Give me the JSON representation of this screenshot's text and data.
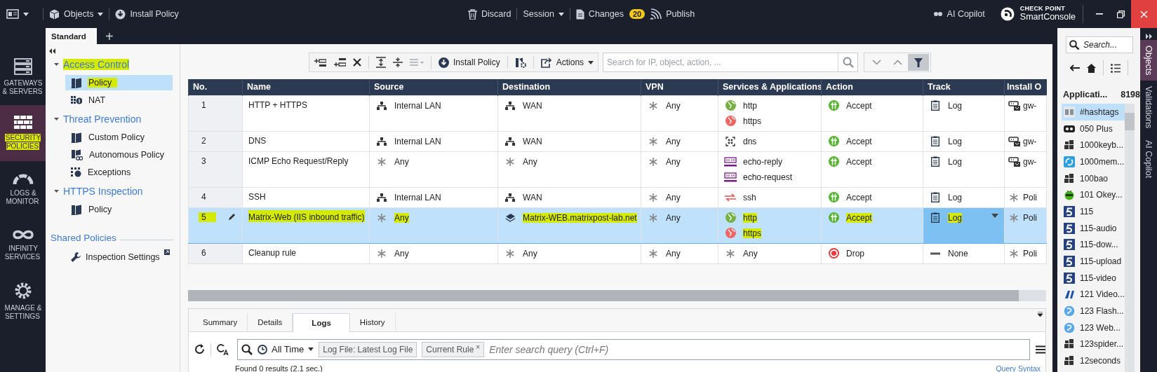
{
  "top_bar": {
    "objects_menu": "Objects",
    "install_policy": "Install Policy",
    "discard": "Discard",
    "session": "Session",
    "changes": "Changes",
    "changes_count": "20",
    "publish": "Publish",
    "ai_copilot": "AI Copilot",
    "brand_top": "CHECK POINT",
    "brand_name": "SmartConsole"
  },
  "policy_tabs": [
    {
      "label": "Standard",
      "selected": true
    }
  ],
  "add_tab": "+",
  "nav": [
    {
      "label": "GATEWAYS & SERVERS",
      "kind": "servers",
      "selected": false,
      "highlighted": false
    },
    {
      "label": "SECURITY POLICIES",
      "kind": "firewall",
      "selected": true,
      "highlighted": true
    },
    {
      "label": "LOGS & MONITOR",
      "kind": "gauge",
      "selected": false,
      "highlighted": false
    },
    {
      "label": "INFINITY SERVICES",
      "kind": "infinity",
      "selected": false,
      "highlighted": false
    },
    {
      "label": "MANAGE & SETTINGS",
      "kind": "gear",
      "selected": false,
      "highlighted": false
    }
  ],
  "tree": [
    {
      "label": "Access Control",
      "expanded": true,
      "highlighted": true,
      "children": [
        {
          "label": "Policy",
          "kind": "policy",
          "selected": true,
          "highlighted": true
        },
        {
          "label": "NAT",
          "kind": "nat",
          "selected": false,
          "highlighted": false
        }
      ]
    },
    {
      "label": "Threat Prevention",
      "expanded": true,
      "highlighted": false,
      "children": [
        {
          "label": "Custom Policy",
          "kind": "policy",
          "selected": false,
          "highlighted": false
        },
        {
          "label": "Autonomous Policy",
          "kind": "autonomous",
          "selected": false,
          "highlighted": false
        },
        {
          "label": "Exceptions",
          "kind": "exceptions",
          "selected": false,
          "highlighted": false
        }
      ]
    },
    {
      "label": "HTTPS Inspection",
      "expanded": true,
      "highlighted": false,
      "children": [
        {
          "label": "Policy",
          "kind": "policy",
          "selected": false,
          "highlighted": false
        }
      ]
    }
  ],
  "shared_policies": {
    "title": "Shared Policies",
    "items": [
      {
        "label": "Inspection Settings",
        "kind": "wrench"
      }
    ]
  },
  "toolbar": {
    "install_policy": "Install Policy",
    "actions": "Actions",
    "search": {
      "placeholder": "Search for IP, object, action, ..."
    }
  },
  "table": {
    "columns": [
      "No.",
      "Name",
      "Source",
      "Destination",
      "VPN",
      "Services & Applications",
      "Action",
      "Track",
      "Install O"
    ],
    "rows": [
      {
        "no": "1",
        "name": "HTTP + HTTPS",
        "source": [
          {
            "kind": "network",
            "text": "Internal LAN"
          }
        ],
        "destination": [
          {
            "kind": "network",
            "text": "WAN"
          }
        ],
        "vpn": [
          {
            "kind": "any",
            "text": "Any"
          }
        ],
        "services": [
          {
            "kind": "globe",
            "color": "#76b043",
            "text": "http"
          },
          {
            "kind": "globe",
            "color": "#f26363",
            "text": "https"
          }
        ],
        "action": {
          "kind": "accept",
          "text": "Accept"
        },
        "track": {
          "kind": "log",
          "text": "Log"
        },
        "install_on": {
          "kind": "gateway",
          "text": "gw-"
        },
        "selected": false,
        "highlighted": false
      },
      {
        "no": "2",
        "name": "DNS",
        "source": [
          {
            "kind": "network",
            "text": "Internal LAN"
          }
        ],
        "destination": [
          {
            "kind": "network",
            "text": "WAN"
          }
        ],
        "vpn": [
          {
            "kind": "any",
            "text": "Any"
          }
        ],
        "services": [
          {
            "kind": "dns",
            "text": "dns"
          }
        ],
        "action": {
          "kind": "accept",
          "text": "Accept"
        },
        "track": {
          "kind": "log",
          "text": "Log"
        },
        "install_on": {
          "kind": "gateway",
          "text": "gw-"
        },
        "selected": false,
        "highlighted": false
      },
      {
        "no": "3",
        "name": "ICMP Echo Request/Reply",
        "source": [
          {
            "kind": "any",
            "text": "Any"
          }
        ],
        "destination": [
          {
            "kind": "any",
            "text": "Any"
          }
        ],
        "vpn": [
          {
            "kind": "any",
            "text": "Any"
          }
        ],
        "services": [
          {
            "kind": "icmp",
            "text": "echo-reply"
          },
          {
            "kind": "icmp",
            "text": "echo-request"
          }
        ],
        "action": {
          "kind": "accept",
          "text": "Accept"
        },
        "track": {
          "kind": "log",
          "text": "Log"
        },
        "install_on": {
          "kind": "gateway",
          "text": "gw-"
        },
        "selected": false,
        "highlighted": false
      },
      {
        "no": "4",
        "name": "SSH",
        "source": [
          {
            "kind": "network",
            "text": "Internal LAN"
          }
        ],
        "destination": [
          {
            "kind": "network",
            "text": "WAN"
          }
        ],
        "vpn": [
          {
            "kind": "any",
            "text": "Any"
          }
        ],
        "services": [
          {
            "kind": "ssh",
            "text": "ssh"
          }
        ],
        "action": {
          "kind": "accept",
          "text": "Accept"
        },
        "track": {
          "kind": "log",
          "text": "Log"
        },
        "install_on": {
          "kind": "any",
          "text": "Poli"
        },
        "selected": false,
        "highlighted": false
      },
      {
        "no": "5",
        "name": "Matrix-Web (IIS inbound traffic)",
        "source": [
          {
            "kind": "any",
            "text": "Any"
          }
        ],
        "destination": [
          {
            "kind": "host",
            "text": "Matrix-WEB.matrixpost-lab.net"
          }
        ],
        "vpn": [
          {
            "kind": "any",
            "text": "Any"
          }
        ],
        "services": [
          {
            "kind": "globe",
            "color": "#76b043",
            "text": "http"
          },
          {
            "kind": "globe",
            "color": "#f26363",
            "text": "https"
          }
        ],
        "action": {
          "kind": "accept",
          "text": "Accept"
        },
        "track": {
          "kind": "log",
          "text": "Log"
        },
        "install_on": {
          "kind": "any",
          "text": "Poli"
        },
        "selected": true,
        "highlighted": true
      },
      {
        "no": "6",
        "name": "Cleanup rule",
        "source": [
          {
            "kind": "any",
            "text": "Any"
          }
        ],
        "destination": [
          {
            "kind": "any",
            "text": "Any"
          }
        ],
        "vpn": [
          {
            "kind": "any",
            "text": "Any"
          }
        ],
        "services": [
          {
            "kind": "any",
            "text": "Any"
          }
        ],
        "action": {
          "kind": "drop",
          "text": "Drop"
        },
        "track": {
          "kind": "none",
          "text": "None"
        },
        "install_on": {
          "kind": "any",
          "text": "Poli"
        },
        "selected": false,
        "highlighted": false
      }
    ]
  },
  "bottom_panel": {
    "tabs": [
      {
        "label": "Summary",
        "selected": false
      },
      {
        "label": "Details",
        "selected": false
      },
      {
        "label": "Logs",
        "selected": true
      },
      {
        "label": "History",
        "selected": false
      }
    ],
    "time_filter": "All Time",
    "chips": [
      {
        "text": "Log File: Latest Log File"
      },
      {
        "text": "Current Rule",
        "close": "×"
      }
    ],
    "search": {
      "placeholder": "Enter search query (Ctrl+F)"
    },
    "results": "Found 0 results (2.1 sec.)",
    "query_syntax": "Query Syntax"
  },
  "objects_panel": {
    "search": {
      "placeholder": "Search..."
    },
    "category": "Applicati...",
    "count": "8198",
    "items": [
      {
        "text": "#hashtags",
        "kind": "pb",
        "selected": true
      },
      {
        "text": "050 Plus",
        "kind": "ring",
        "selected": false
      },
      {
        "text": "1000keyb...",
        "kind": "grid",
        "selected": false
      },
      {
        "text": "1000mem...",
        "kind": "swirl",
        "selected": false
      },
      {
        "text": "100bao",
        "kind": "grid",
        "selected": false
      },
      {
        "text": "101 Okey...",
        "kind": "bug",
        "selected": false
      },
      {
        "text": "115",
        "kind": "s5",
        "selected": false
      },
      {
        "text": "115-audio",
        "kind": "s5",
        "selected": false
      },
      {
        "text": "115-dow...",
        "kind": "s5",
        "selected": false
      },
      {
        "text": "115-upload",
        "kind": "s5",
        "selected": false
      },
      {
        "text": "115-video",
        "kind": "s5",
        "selected": false
      },
      {
        "text": "121 Video...",
        "kind": "n121",
        "selected": false
      },
      {
        "text": "123 Flash...",
        "kind": "bubble",
        "selected": false
      },
      {
        "text": "123 Web...",
        "kind": "bubble",
        "selected": false
      },
      {
        "text": "123spider...",
        "kind": "grid",
        "selected": false
      },
      {
        "text": "12seconds",
        "kind": "grid",
        "selected": false
      }
    ]
  },
  "side_tabs": [
    {
      "label": "Objects",
      "selected": true
    },
    {
      "label": "Validations",
      "selected": false
    },
    {
      "label": "AI Copilot",
      "selected": false
    }
  ]
}
